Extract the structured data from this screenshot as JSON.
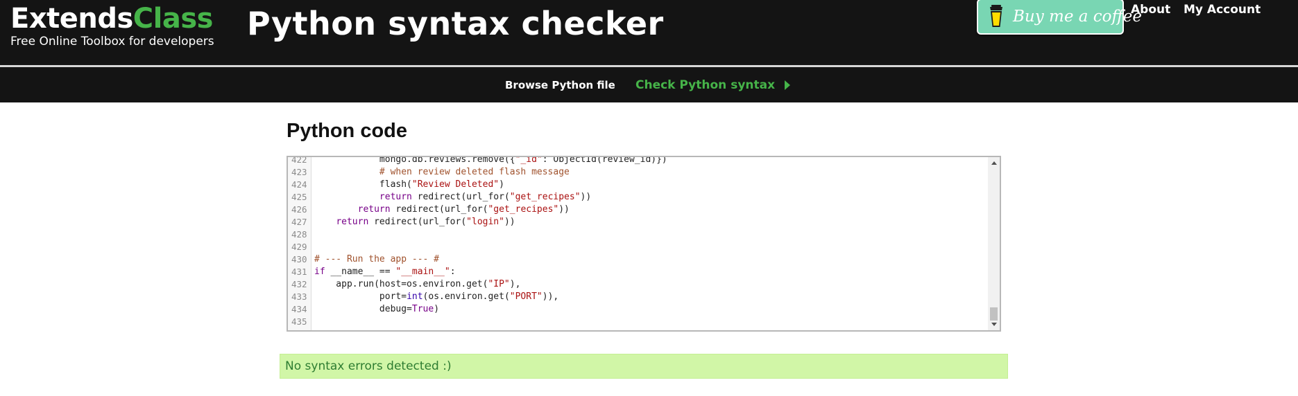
{
  "header": {
    "brand_part1": "Extends",
    "brand_part2": "Class",
    "tagline": "Free Online Toolbox for developers",
    "page_title": "Python syntax checker",
    "coffee_button": "Buy me a coffee",
    "nav_about": "About",
    "nav_account": "My Account"
  },
  "nav": {
    "browse_label": "Browse Python file",
    "check_label": "Check Python syntax"
  },
  "main": {
    "section_title": "Python code",
    "result_message": "No syntax errors detected :)"
  },
  "editor": {
    "lines": [
      {
        "number": "422",
        "text": "            mongo.db.reviews.remove({\"_id\": ObjectId(review_id)})"
      },
      {
        "number": "423",
        "text": "            # when review deleted flash message"
      },
      {
        "number": "424",
        "text": "            flash(\"Review Deleted\")"
      },
      {
        "number": "425",
        "text": "            return redirect(url_for(\"get_recipes\"))"
      },
      {
        "number": "426",
        "text": "        return redirect(url_for(\"get_recipes\"))"
      },
      {
        "number": "427",
        "text": "    return redirect(url_for(\"login\"))"
      },
      {
        "number": "428",
        "text": ""
      },
      {
        "number": "429",
        "text": ""
      },
      {
        "number": "430",
        "text": "# --- Run the app --- #"
      },
      {
        "number": "431",
        "text": "if __name__ == \"__main__\":"
      },
      {
        "number": "432",
        "text": "    app.run(host=os.environ.get(\"IP\"),"
      },
      {
        "number": "433",
        "text": "            port=int(os.environ.get(\"PORT\")),"
      },
      {
        "number": "434",
        "text": "            debug=True)"
      },
      {
        "number": "435",
        "text": ""
      }
    ]
  },
  "colors": {
    "header_bg": "#141414",
    "brand_green": "#46b449",
    "coffee_bg": "#79d6b3",
    "result_bg": "#d1f6a7",
    "result_text": "#2e7d32"
  },
  "icons": {
    "coffee": "coffee-cup-icon",
    "nav_arrow": "triangle-right-icon"
  }
}
